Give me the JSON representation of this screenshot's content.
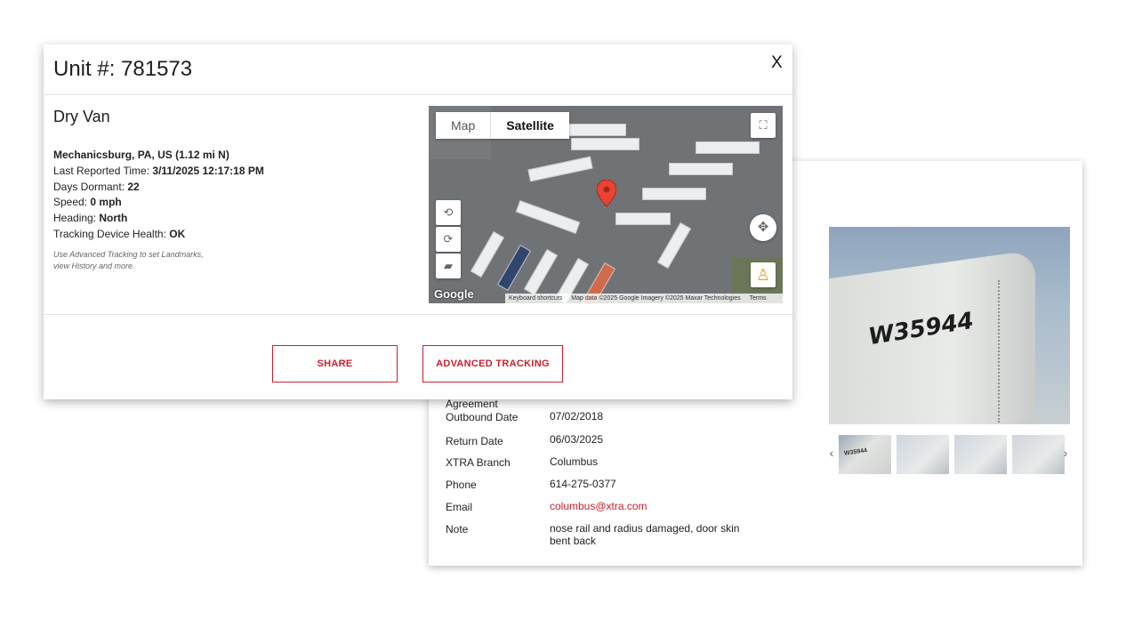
{
  "modal": {
    "title": "Unit #: 781573",
    "close_label": "X",
    "unit_type": "Dry Van",
    "location": "Mechanicsburg, PA, US (1.12 mi N)",
    "fields": [
      {
        "label": "Last Reported Time:",
        "value": "3/11/2025 12:17:18 PM"
      },
      {
        "label": "Days Dormant:",
        "value": "22"
      },
      {
        "label": "Speed:",
        "value": "0 mph"
      },
      {
        "label": "Heading:",
        "value": "North"
      },
      {
        "label": "Tracking Device Health:",
        "value": "OK"
      }
    ],
    "hint_line1": "Use Advanced Tracking to set Landmarks,",
    "hint_line2": "view History and more.",
    "share_label": "SHARE",
    "advanced_label": "ADVANCED TRACKING"
  },
  "map": {
    "tab_map": "Map",
    "tab_satellite": "Satellite",
    "google_label": "Google",
    "footer_shortcuts": "Keyboard shortcuts",
    "footer_data": "Map data ©2025 Google Imagery ©2025 Maxar Technologies",
    "footer_terms": "Terms"
  },
  "details": {
    "rows": [
      {
        "label": "Agreement",
        "value": ""
      },
      {
        "label": "Outbound Date",
        "value": "07/02/2018"
      },
      {
        "label": "Return Date",
        "value": "06/03/2025"
      },
      {
        "label": "XTRA Branch",
        "value": "Columbus"
      },
      {
        "label": "Phone",
        "value": "614-275-0377"
      },
      {
        "label": "Email",
        "value": "columbus@xtra.com"
      },
      {
        "label": "Note",
        "value": "nose rail and radius damaged, door skin bent back"
      }
    ]
  },
  "photo": {
    "trailer_number": "W35944",
    "thumb_text": "W35944"
  },
  "colors": {
    "accent": "#c8202f"
  }
}
